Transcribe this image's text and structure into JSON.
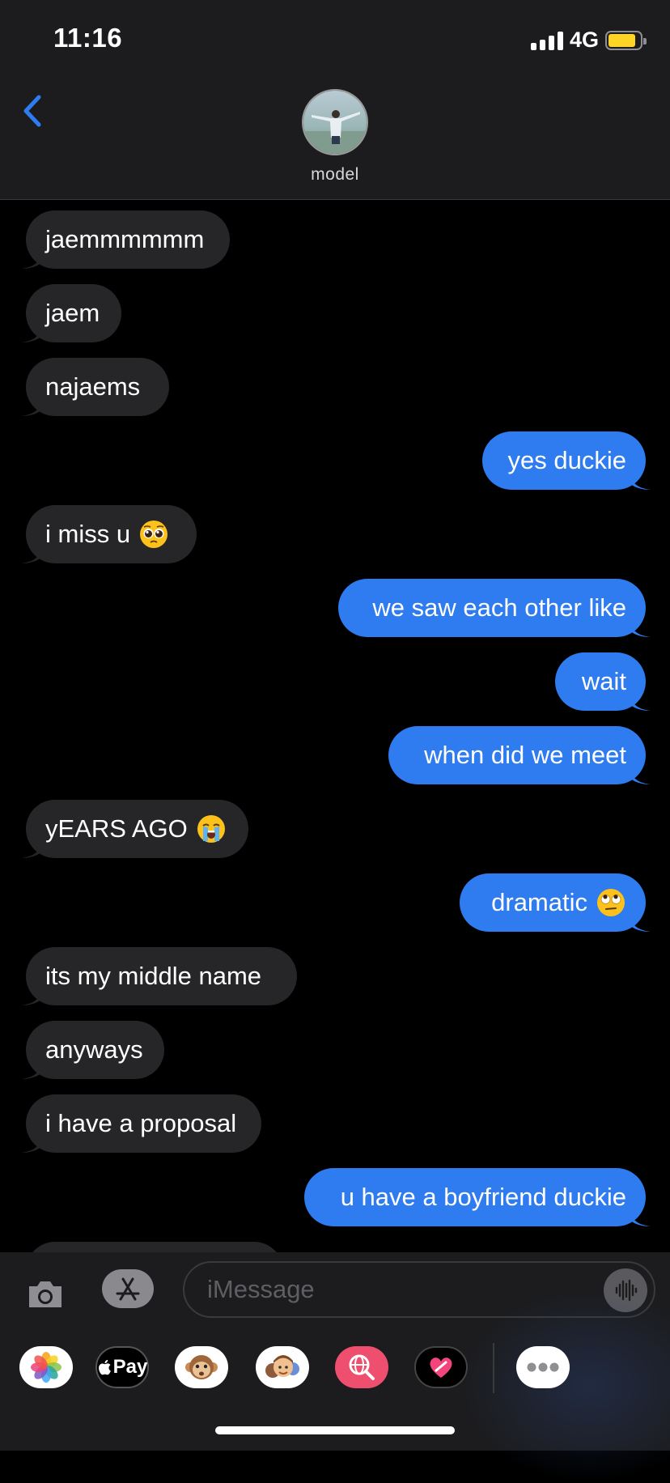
{
  "status_bar": {
    "time": "11:16",
    "network": "4G",
    "battery_color": "#ffd426"
  },
  "header": {
    "contact_name": "model"
  },
  "messages": [
    {
      "from": "them",
      "text": "jaemmmmmm",
      "emoji": ""
    },
    {
      "from": "them",
      "text": "jaem",
      "emoji": ""
    },
    {
      "from": "them",
      "text": "najaems",
      "emoji": ""
    },
    {
      "from": "me",
      "text": "yes duckie",
      "emoji": ""
    },
    {
      "from": "them",
      "text": "i miss u",
      "emoji": "pleading-face"
    },
    {
      "from": "me",
      "text": "we saw each other like",
      "emoji": ""
    },
    {
      "from": "me",
      "text": "wait",
      "emoji": ""
    },
    {
      "from": "me",
      "text": "when did we meet",
      "emoji": ""
    },
    {
      "from": "them",
      "text": "yEARS AGO",
      "emoji": "loudly-crying-face"
    },
    {
      "from": "me",
      "text": "dramatic",
      "emoji": "rolling-eyes-face"
    },
    {
      "from": "them",
      "text": "its my middle name",
      "emoji": ""
    },
    {
      "from": "them",
      "text": "anyways",
      "emoji": ""
    },
    {
      "from": "them",
      "text": "i have a proposal",
      "emoji": ""
    },
    {
      "from": "me",
      "text": "u have a boyfriend duckie",
      "emoji": ""
    }
  ],
  "input": {
    "placeholder": "iMessage"
  },
  "app_tray": [
    {
      "name": "photos-app-icon"
    },
    {
      "name": "apple-pay-app-icon",
      "label": "Pay"
    },
    {
      "name": "animoji-app-icon"
    },
    {
      "name": "memoji-app-icon"
    },
    {
      "name": "image-search-app-icon"
    },
    {
      "name": "digital-touch-app-icon"
    },
    {
      "name": "more-apps-icon"
    }
  ],
  "colors": {
    "incoming_bubble": "#262628",
    "outgoing_bubble": "#2f7bf0",
    "accent": "#2f7bf0"
  }
}
